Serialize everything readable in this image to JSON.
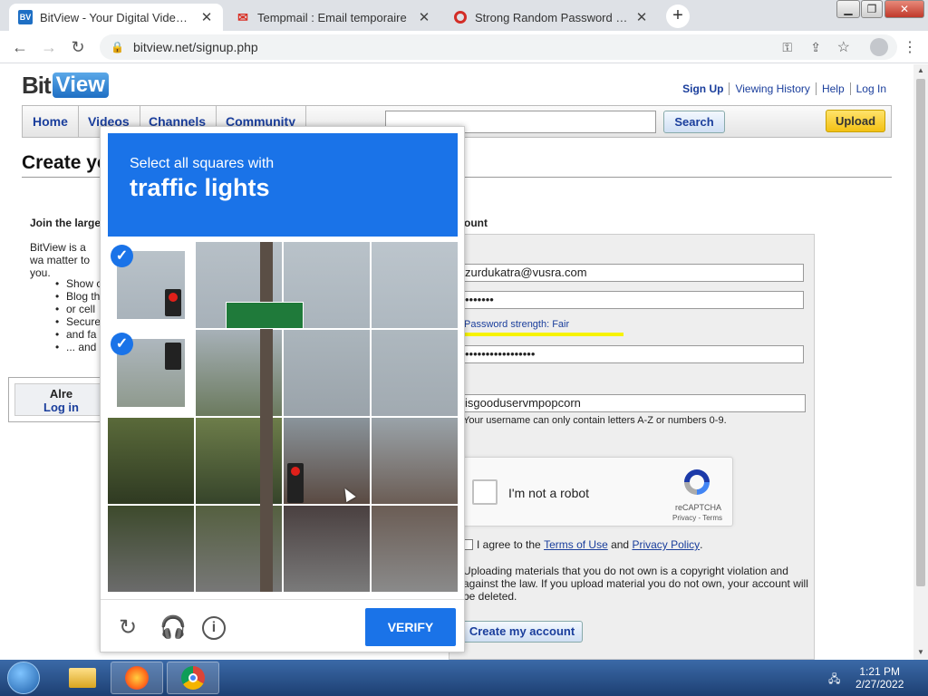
{
  "browser": {
    "tabs": [
      {
        "label": "BitView - Your Digital Video Repo",
        "favicon": "bitview-icon"
      },
      {
        "label": "Tempmail : Email temporaire",
        "favicon": "gmail-icon"
      },
      {
        "label": "Strong Random Password Genera",
        "favicon": "lastpass-icon"
      }
    ],
    "url": "bitview.net/signup.php"
  },
  "site": {
    "logo_a": "Bit",
    "logo_b": "View",
    "toplinks": [
      "Sign Up",
      "Viewing History",
      "Help",
      "Log In"
    ],
    "nav": [
      "Home",
      "Videos",
      "Channels",
      "Community"
    ],
    "search_label": "Search",
    "upload_label": "Upload",
    "page_title": "Create yo",
    "left_heading": "Join the large",
    "left_text": "BitView is a wa matter to you.",
    "left_list": [
      "Show c",
      "Blog th",
      "or cell",
      "Secure",
      "and fa",
      "... and"
    ],
    "login_box": {
      "line1": "Alre",
      "line2": "Log in"
    },
    "right_heading": "ount",
    "form": {
      "email": "zurdukatra@vusra.com",
      "password": "•••••••",
      "strength": "Password strength: Fair",
      "confirm": "•••••••••••••••••",
      "username": "isgooduservmpopcorn",
      "username_hint": "Your username can only contain letters A-Z or numbers 0-9.",
      "agree_prefix": "I agree to the ",
      "terms": "Terms of Use",
      "and": " and ",
      "privacy": "Privacy Policy",
      "period": ".",
      "warning": "Uploading materials that you do not own is a copyright violation and against the law. If you upload material you do not own, your account will be deleted.",
      "create_label": "Create my account"
    }
  },
  "recaptcha_widget": {
    "label": "I'm not a robot",
    "brand": "reCAPTCHA",
    "privacy": "Privacy - Terms"
  },
  "captcha": {
    "subtitle": "Select all squares with",
    "target": "traffic lights",
    "verify_label": "VERIFY",
    "selected_tiles": [
      0,
      4
    ],
    "accent": "#1a73e8"
  },
  "taskbar": {
    "time": "1:21 PM",
    "date": "2/27/2022"
  }
}
